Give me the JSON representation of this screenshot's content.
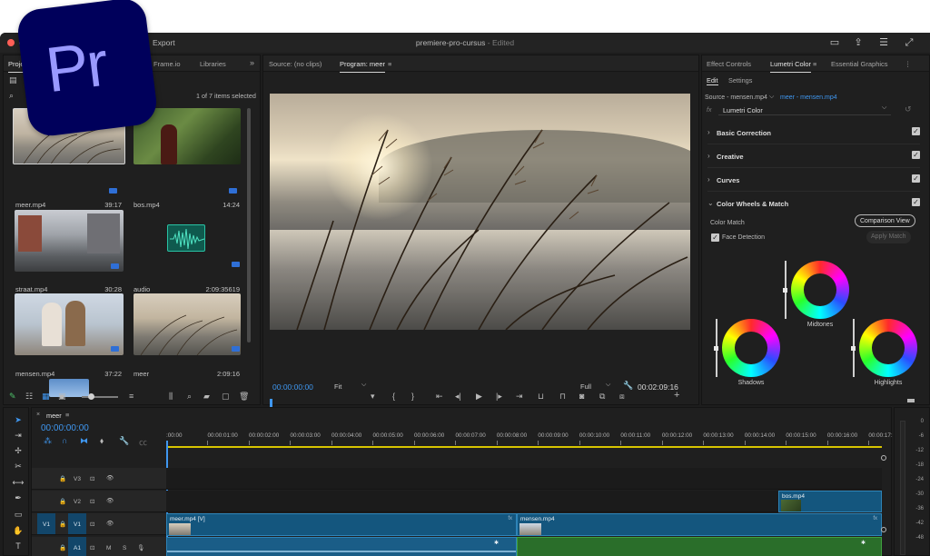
{
  "app": {
    "title": "premiere-pro-cursus",
    "title_sep": " - ",
    "status": "Edited",
    "export_label": "Export",
    "logo_text": "Pr",
    "accent": "#3f97f0",
    "logo_bg": "#00005b",
    "logo_fg": "#9999ff"
  },
  "project_panel": {
    "tabs": [
      {
        "label": "Project"
      },
      {
        "label": "Frame.io"
      },
      {
        "label": "Libraries"
      }
    ],
    "more": "»",
    "folder": "pr",
    "selection_info": "1 of 7 items selected",
    "clips": [
      {
        "name": "meer.mp4",
        "duration": "39:17"
      },
      {
        "name": "bos.mp4",
        "duration": "14:24"
      },
      {
        "name": "straat.mp4",
        "duration": "30:28"
      },
      {
        "name": "audio",
        "duration": "2:09:35619"
      },
      {
        "name": "mensen.mp4",
        "duration": "37:22"
      },
      {
        "name": "meer",
        "duration": "2:09:16"
      }
    ]
  },
  "source_monitor": {
    "tab": "Source: (no clips)"
  },
  "program_monitor": {
    "tab": "Program: meer",
    "timecode": "00:00:00:00",
    "fit": "Fit",
    "quality": "Full",
    "duration": "00:02:09:16"
  },
  "lumetri": {
    "tabs": [
      {
        "label": "Effect Controls"
      },
      {
        "label": "Lumetri Color"
      },
      {
        "label": "Essential Graphics"
      }
    ],
    "subtabs": [
      {
        "label": "Edit"
      },
      {
        "label": "Settings"
      }
    ],
    "source": "Source - mensen.mp4",
    "target": "meer - mensen.mp4",
    "effect": "Lumetri Color",
    "sections": [
      {
        "label": "Basic Correction"
      },
      {
        "label": "Creative"
      },
      {
        "label": "Curves"
      },
      {
        "label": "Color Wheels & Match"
      }
    ],
    "color_match": "Color Match",
    "comparison_view": "Comparison View",
    "face_detection": "Face Detection",
    "apply_match": "Apply Match",
    "wheels": {
      "midtones": "Midtones",
      "shadows": "Shadows",
      "highlights": "Highlights"
    }
  },
  "timeline": {
    "sequence": "meer",
    "timecode": "00:00:00:00",
    "ruler": [
      ":00:00",
      "00:00:01:00",
      "00:00:02:00",
      "00:00:03:00",
      "00:00:04:00",
      "00:00:05:00",
      "00:00:06:00",
      "00:00:07:00",
      "00:00:08:00",
      "00:00:09:00",
      "00:00:10:00",
      "00:00:11:00",
      "00:00:12:00",
      "00:00:13:00",
      "00:00:14:00",
      "00:00:15:00",
      "00:00:16:00",
      "00:00:17:"
    ],
    "tracks": [
      {
        "name": "V3"
      },
      {
        "name": "V2"
      },
      {
        "name": "V1",
        "source": "V1"
      },
      {
        "name": "A1",
        "source": "A1"
      }
    ],
    "clips": {
      "v2": "bos.mp4",
      "v1_a": "meer.mp4 [V]",
      "v1_b": "mensen.mp4"
    },
    "meter_labels": [
      "0",
      "-6",
      "-12",
      "-18",
      "-24",
      "-30",
      "-36",
      "-42",
      "-48"
    ]
  }
}
